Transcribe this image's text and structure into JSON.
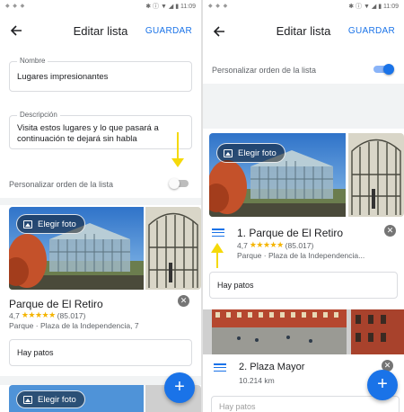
{
  "status_icons": "✱ ⓘ ▼ ◢ ▮ 11:09",
  "left": {
    "title": "Editar lista",
    "save_label": "GUARDAR",
    "name_label": "Nombre",
    "name_value": "Lugares impresionantes",
    "desc_label": "Descripción",
    "desc_value": "Visita estos lugares y lo que pasará a continuación te dejará sin habla",
    "toggle_label": "Personalizar orden de la lista",
    "toggle_on": false,
    "photo_button": "Elegir foto",
    "place": {
      "name": "Parque de El Retiro",
      "rating": "4,7",
      "stars": "★★★★★",
      "reviews": "(85.017)",
      "address": "Parque · Plaza de la Independencia, 7",
      "note": "Hay patos"
    },
    "photo_button_2": "Elegir foto"
  },
  "right": {
    "title": "Editar lista",
    "save_label": "GUARDAR",
    "toggle_label": "Personalizar orden de la lista",
    "toggle_on": true,
    "photo_button": "Elegir foto",
    "place1": {
      "name": "1. Parque de El Retiro",
      "rating": "4,7",
      "stars": "★★★★★",
      "reviews": "(85.017)",
      "address": "Parque · Plaza de la Independencia...",
      "note": "Hay patos"
    },
    "place2": {
      "name": "2. Plaza Mayor",
      "distance": "10.214 km",
      "note": "Hay patos"
    }
  },
  "colors": {
    "accent": "#1a73e8",
    "arrow": "#f5d90a",
    "toggle_off_track": "#bdbdbd",
    "toggle_on_track": "#8ab4f8"
  },
  "fab_icon": "+"
}
